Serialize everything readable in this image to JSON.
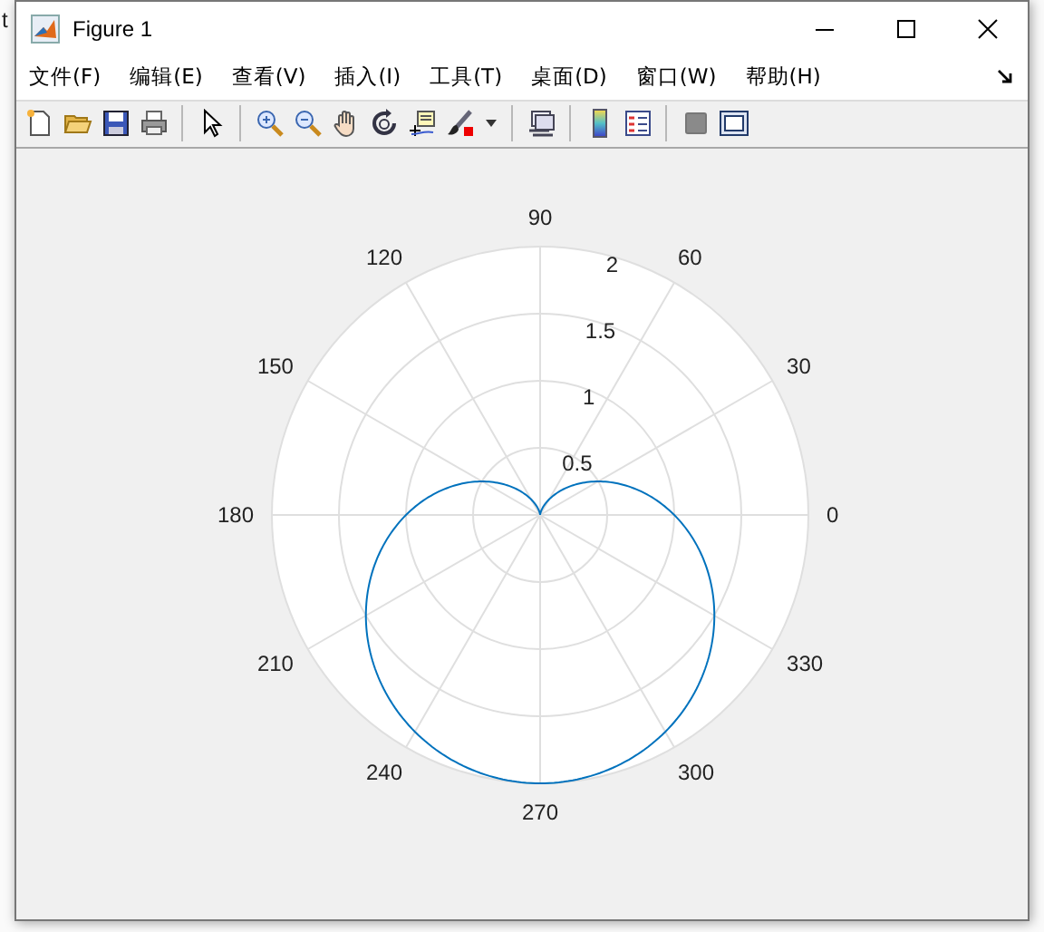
{
  "background": {
    "text": "t"
  },
  "window": {
    "title": "Figure 1"
  },
  "menu": [
    "文件(F)",
    "编辑(E)",
    "查看(V)",
    "插入(I)",
    "工具(T)",
    "桌面(D)",
    "窗口(W)",
    "帮助(H)"
  ],
  "axes": {
    "angle_labels": [
      "0",
      "30",
      "60",
      "90",
      "120",
      "150",
      "180",
      "210",
      "240",
      "270",
      "300",
      "330"
    ],
    "radius_labels": [
      "2",
      "1.5",
      "1",
      "0.5"
    ]
  }
}
